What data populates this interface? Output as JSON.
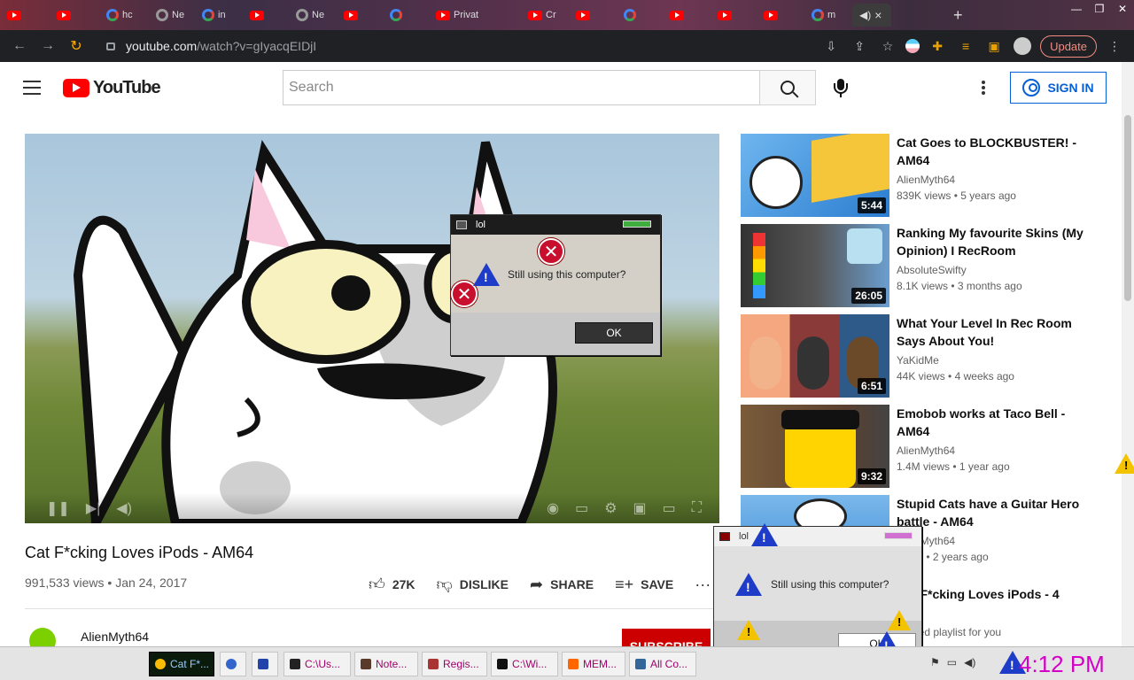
{
  "browser": {
    "tabs": [
      {
        "label": "",
        "icon": "youtube"
      },
      {
        "label": "",
        "icon": "youtube"
      },
      {
        "label": "hc",
        "icon": "google"
      },
      {
        "label": "Ne",
        "icon": "github"
      },
      {
        "label": "in",
        "icon": "google"
      },
      {
        "label": "",
        "icon": "youtube"
      },
      {
        "label": "Ne",
        "icon": "github"
      },
      {
        "label": "",
        "icon": "youtube"
      },
      {
        "label": "",
        "icon": "google"
      },
      {
        "label": "Privat",
        "icon": "youtube"
      },
      {
        "label": "Cr",
        "icon": "youtube"
      },
      {
        "label": "",
        "icon": "youtube"
      },
      {
        "label": "",
        "icon": "google"
      },
      {
        "label": "",
        "icon": "youtube"
      },
      {
        "label": "",
        "icon": "youtube"
      },
      {
        "label": "",
        "icon": "youtube"
      },
      {
        "label": "m",
        "icon": "google"
      }
    ],
    "active_tab_close": "×",
    "new_tab": "+",
    "url_host": "youtube.com",
    "url_path": "/watch?v=gIyacqEIDjI",
    "update_label": "Update"
  },
  "youtube": {
    "logo_text": "YouTube",
    "search_placeholder": "Search",
    "signin_label": "SIGN IN"
  },
  "video": {
    "title": "Cat F*cking Loves iPods - AM64",
    "views": "991,533 views",
    "date": "Jan 24, 2017",
    "meta_sep": "•",
    "likes": "27K",
    "dislike_label": "DISLIKE",
    "share_label": "SHARE",
    "save_label": "SAVE",
    "channel": "AlienMyth64",
    "subscribe_label": "SUBSCRIBE"
  },
  "related": [
    {
      "title": "Cat Goes to BLOCKBUSTER! - AM64",
      "channel": "AlienMyth64",
      "views": "839K views",
      "age": "5 years ago",
      "duration": "5:44"
    },
    {
      "title": "Ranking My favourite Skins (My Opinion) I RecRoom",
      "channel": "AbsoluteSwifty",
      "views": "8.1K views",
      "age": "3 months ago",
      "duration": "26:05"
    },
    {
      "title": "What Your Level In Rec Room Says About You!",
      "channel": "YaKidMe",
      "views": "44K views",
      "age": "4 weeks ago",
      "duration": "6:51"
    },
    {
      "title": "Emobob works at Taco Bell - AM64",
      "channel": "AlienMyth64",
      "views": "1.4M views",
      "age": "1 year ago",
      "duration": "9:32"
    },
    {
      "title": "Stupid Cats have a Guitar Hero battle - AM64",
      "channel": "AlienMyth64",
      "views": "views",
      "age": "2 years ago",
      "duration": ""
    },
    {
      "title": "Cat F*cking Loves iPods - 4",
      "channel": "nalized playlist for you",
      "views": "",
      "age": "",
      "duration": ""
    }
  ],
  "related_sep": "•",
  "dialogs": [
    {
      "title": "lol",
      "message": "Still using this computer?",
      "ok": "OK"
    },
    {
      "title": "lol",
      "message": "Still using this computer?",
      "ok": "OK"
    }
  ],
  "taskbar": {
    "tasks": [
      {
        "label": "Cat F*..."
      },
      {
        "label": ""
      },
      {
        "label": ""
      },
      {
        "label": "C:\\Us..."
      },
      {
        "label": "Note..."
      },
      {
        "label": "Regis..."
      },
      {
        "label": "C:\\Wi..."
      },
      {
        "label": "MEM..."
      },
      {
        "label": "All Co..."
      }
    ],
    "clock": "4:12 PM"
  },
  "colors": {
    "yt_red": "#ff0000",
    "signin_blue": "#065fd4",
    "clock_magenta": "#d400c8",
    "task_text": "#a0006a"
  }
}
